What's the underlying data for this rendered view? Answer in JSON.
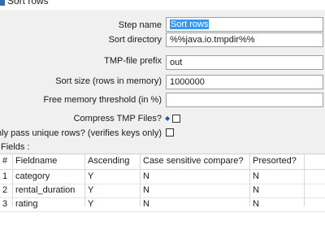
{
  "window": {
    "title": "Sort rows",
    "icon": "sort-rows-icon"
  },
  "form": {
    "step_name_label": "Step name",
    "step_name_value": "Sort rows",
    "sort_directory_label": "Sort directory",
    "sort_directory_value": "%%java.io.tmpdir%%",
    "tmp_prefix_label": "TMP-file prefix",
    "tmp_prefix_value": "out",
    "sort_size_label": "Sort size (rows in memory)",
    "sort_size_value": "1000000",
    "free_memory_label": "Free memory threshold (in %)",
    "free_memory_value": "",
    "compress_label": "Compress TMP Files?",
    "compress_checked": false,
    "unique_label": "Only pass unique rows? (verifies keys only)",
    "unique_checked": false
  },
  "fields": {
    "label": "Fields :",
    "columns": [
      "#",
      "Fieldname",
      "Ascending",
      "Case sensitive compare?",
      "Presorted?"
    ],
    "rows": [
      [
        "1",
        "category",
        "Y",
        "N",
        "N"
      ],
      [
        "2",
        "rental_duration",
        "Y",
        "N",
        "N"
      ],
      [
        "3",
        "rating",
        "Y",
        "N",
        "N"
      ]
    ]
  }
}
